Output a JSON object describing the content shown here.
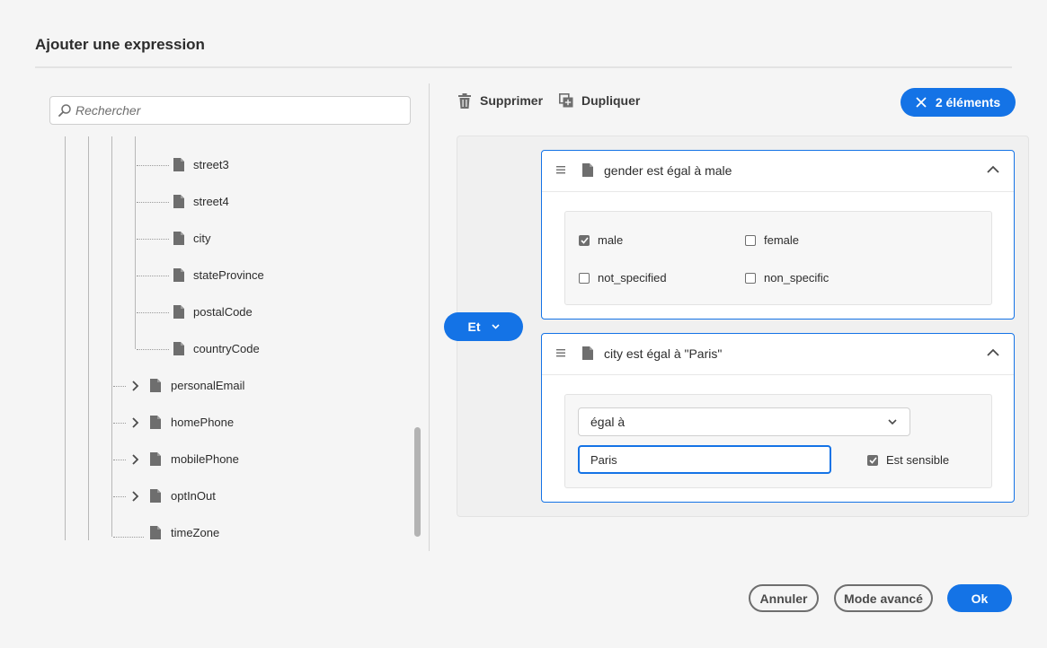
{
  "dialog": {
    "title": "Ajouter une expression"
  },
  "search": {
    "placeholder": "Rechercher",
    "icon": "search-icon"
  },
  "tree": {
    "leaf_items": [
      "street3",
      "street4",
      "city",
      "stateProvince",
      "postalCode",
      "countryCode"
    ],
    "branch_items": [
      "personalEmail",
      "homePhone",
      "mobilePhone",
      "optInOut"
    ],
    "last_item": "timeZone"
  },
  "toolbar": {
    "delete_label": "Supprimer",
    "duplicate_label": "Dupliquer",
    "selection_count": "2 éléments"
  },
  "group": {
    "operator": "Et"
  },
  "conditions": [
    {
      "label": "gender est égal à male",
      "options": [
        {
          "label": "male",
          "checked": true
        },
        {
          "label": "female",
          "checked": false
        },
        {
          "label": "not_specified",
          "checked": false
        },
        {
          "label": "non_specific",
          "checked": false
        }
      ]
    },
    {
      "label": "city est égal à \"Paris\"",
      "operator_select": "égal à",
      "value": "Paris",
      "case_sensitive_label": "Est sensible",
      "case_sensitive": true
    }
  ],
  "footer": {
    "cancel_label": "Annuler",
    "advanced_label": "Mode avancé",
    "ok_label": "Ok"
  },
  "colors": {
    "accent": "#1473e6",
    "background": "#f5f5f5"
  }
}
